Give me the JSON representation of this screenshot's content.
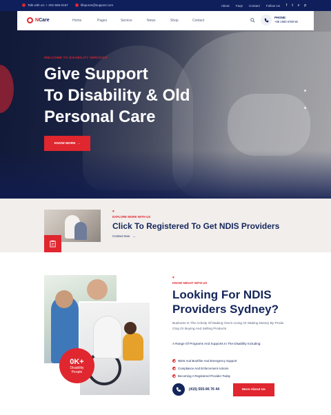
{
  "topbar": {
    "phone": "Talk with us: + 202-555-0167",
    "email": "lifepures@support.com",
    "links": [
      "About",
      "Faqs",
      "Contact",
      "Follow Us"
    ],
    "social_icons": [
      "facebook-icon",
      "twitter-icon",
      "vimeo-icon",
      "pinterest-icon"
    ]
  },
  "header": {
    "logo_letter": "N",
    "logo_text": "Care",
    "nav": [
      "Home",
      "Pages",
      "Service",
      "News",
      "Shop",
      "Contact"
    ],
    "phone_label": "PHONE:",
    "phone_number": "+88 1900 6789 56"
  },
  "hero": {
    "subtitle": "WELCOME TO DISABILITY SERVICES",
    "title_line1": "Give Support",
    "title_line2": "To Disability & Old",
    "title_line3": "Personal Care",
    "button": "KNOW MORE"
  },
  "cta": {
    "subtitle": "EXPLORE MORE WITH US",
    "title": "Click To Registered To Get NDIS Providers",
    "link": "Contact Now"
  },
  "about": {
    "stat_number": "0K+",
    "stat_label_line1": "Disability",
    "stat_label_line2": "People",
    "subtitle": "KNOW ABOUT WITH US",
    "title_line1": "Looking For NDIS",
    "title_line2": "Providers Sydney?",
    "paragraph": "Business Is The Activity Of Making One's Living Or Making Money By Produ Cing Or Buying And Selling Products",
    "paragraph2": "A Range Of Programs And Supports In The Disability Including:",
    "list": [
      "NDIS And Bushfire And Emergency Support",
      "Compliance And Enforcement Actions",
      "Becoming A Registered Provider Today"
    ],
    "call_number": "(415) 555-96 76 44",
    "more_button": "More About Us"
  },
  "colors": {
    "accent": "#e0262e",
    "navy": "#14255a",
    "topbar": "#0f1f5c",
    "cta_bg": "#f1eeec"
  }
}
